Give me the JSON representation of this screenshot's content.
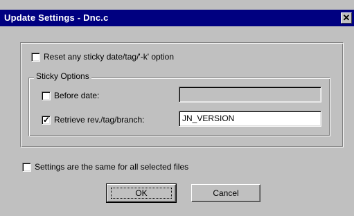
{
  "window": {
    "title": "Update Settings - Dnc.c",
    "close_glyph": "✕"
  },
  "options": {
    "reset_label": "Reset any sticky date/tag/'-k' option",
    "reset_checked": false,
    "sticky_group_label": "Sticky Options",
    "before_date_label": "Before date:",
    "before_date_checked": false,
    "before_date_value": "",
    "retrieve_label": "Retrieve rev./tag/branch:",
    "retrieve_checked": true,
    "retrieve_value": "JN_VERSION",
    "same_settings_label": "Settings are the same for all selected files",
    "same_settings_checked": false
  },
  "buttons": {
    "ok": "OK",
    "cancel": "Cancel"
  },
  "icons": {
    "close": "close-icon",
    "check": "checkmark-icon"
  }
}
